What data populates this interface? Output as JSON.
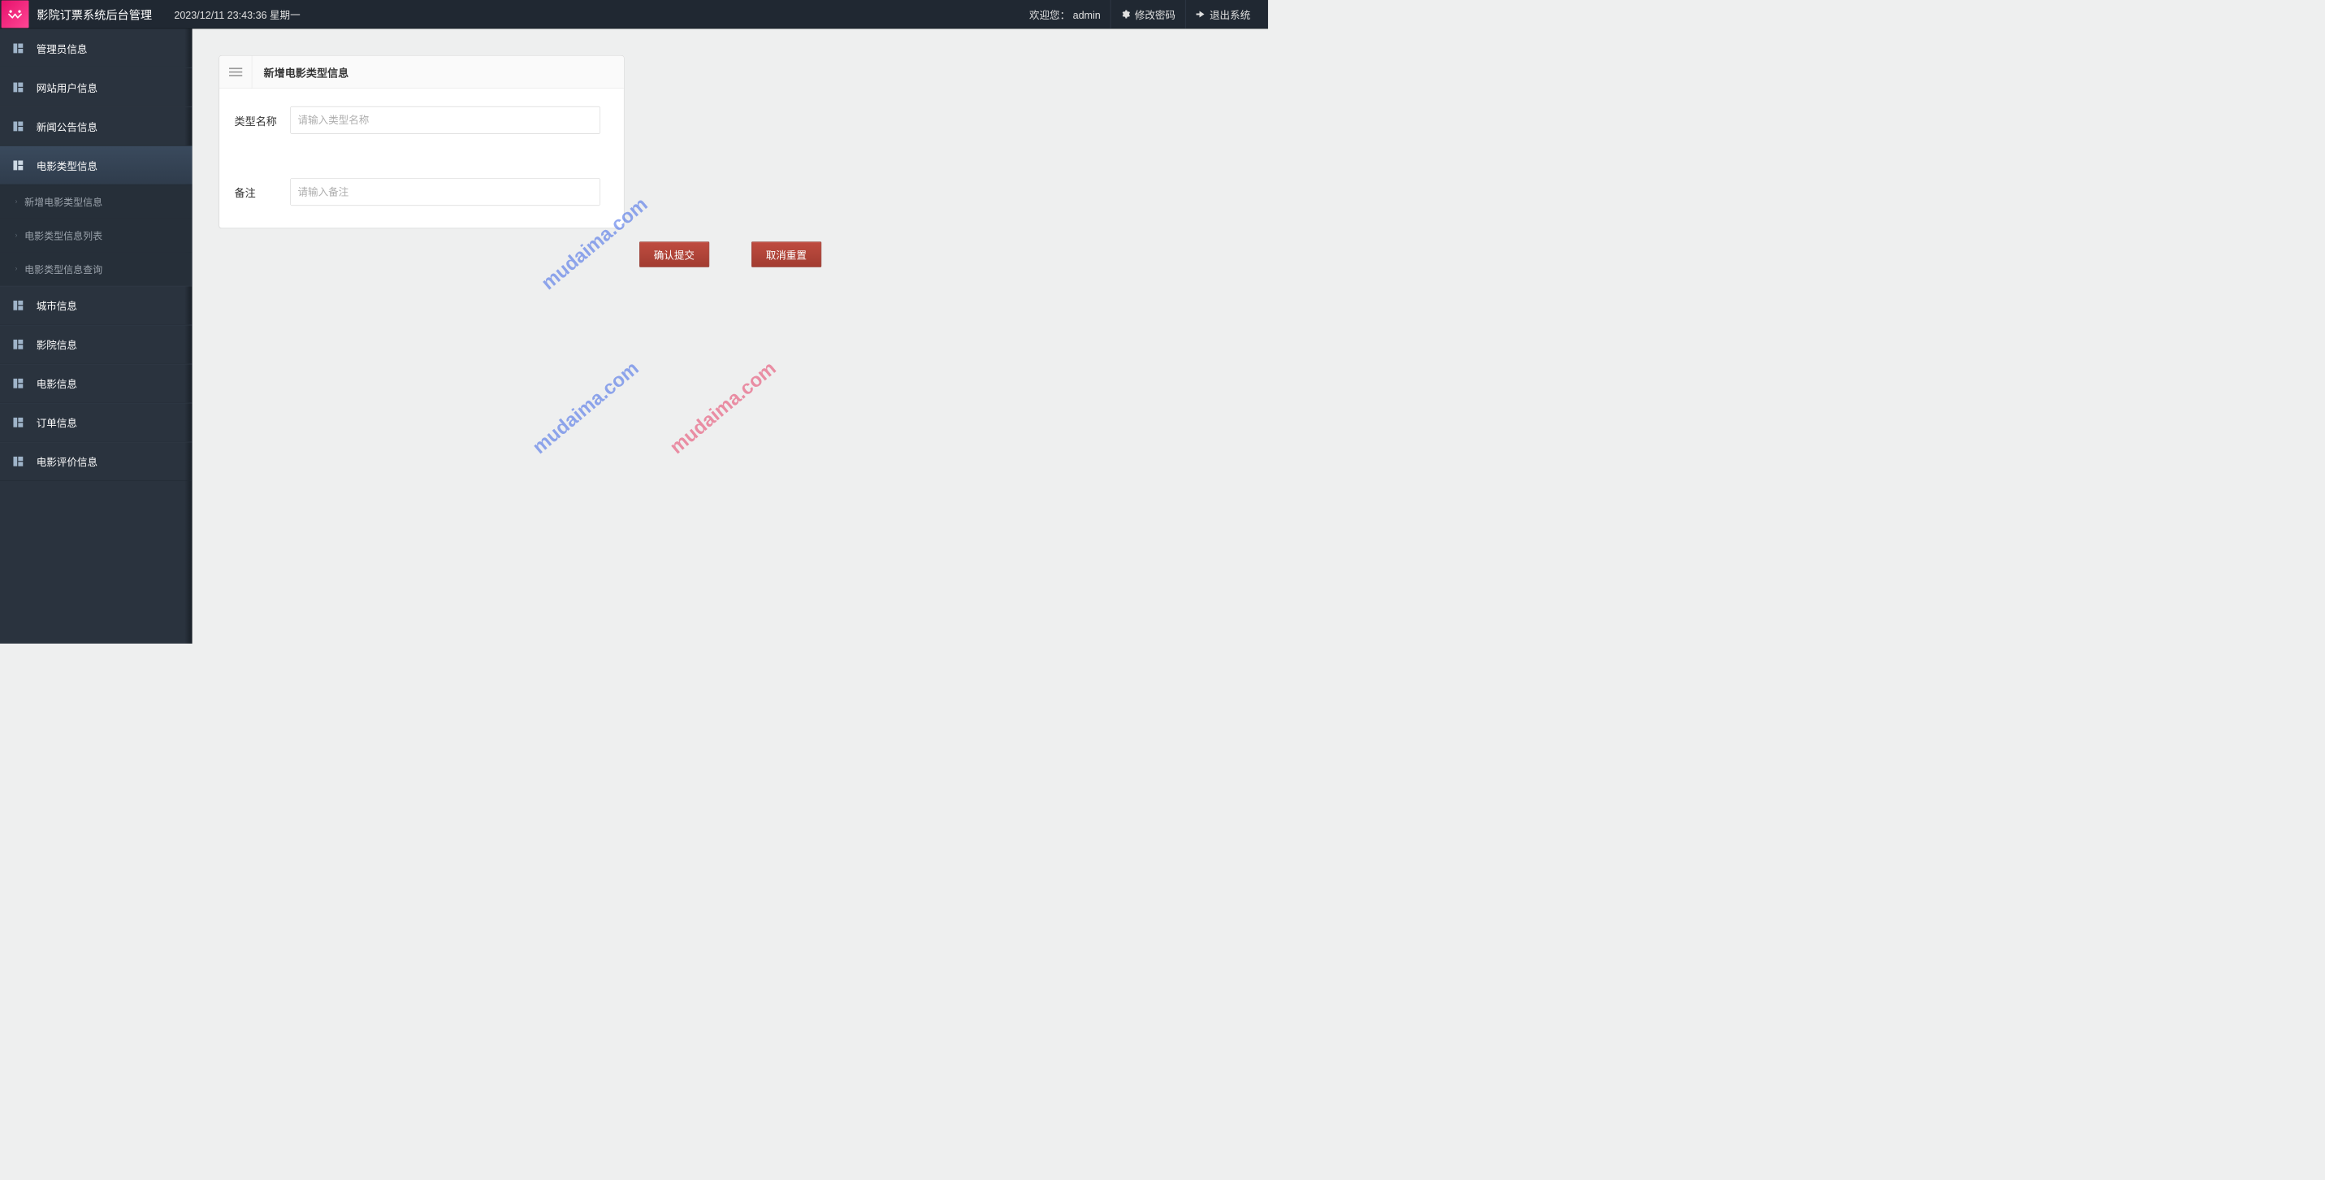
{
  "header": {
    "app_title": "影院订票系统后台管理",
    "timestamp": "2023/12/11 23:43:36 星期一",
    "welcome": "欢迎您： admin",
    "change_pw": "修改密码",
    "logout": "退出系统"
  },
  "sidebar": {
    "items": [
      {
        "label": "管理员信息"
      },
      {
        "label": "网站用户信息"
      },
      {
        "label": "新闻公告信息"
      },
      {
        "label": "电影类型信息"
      },
      {
        "label": "城市信息"
      },
      {
        "label": "影院信息"
      },
      {
        "label": "电影信息"
      },
      {
        "label": "订单信息"
      },
      {
        "label": "电影评价信息"
      }
    ],
    "sub_items": [
      {
        "label": "新增电影类型信息"
      },
      {
        "label": "电影类型信息列表"
      },
      {
        "label": "电影类型信息查询"
      }
    ]
  },
  "panel": {
    "title": "新增电影类型信息",
    "fields": {
      "name_label": "类型名称",
      "name_placeholder": "请输入类型名称",
      "remark_label": "备注",
      "remark_placeholder": "请输入备注"
    },
    "buttons": {
      "submit": "确认提交",
      "reset": "取消重置"
    }
  },
  "watermark": "mudaima.com"
}
